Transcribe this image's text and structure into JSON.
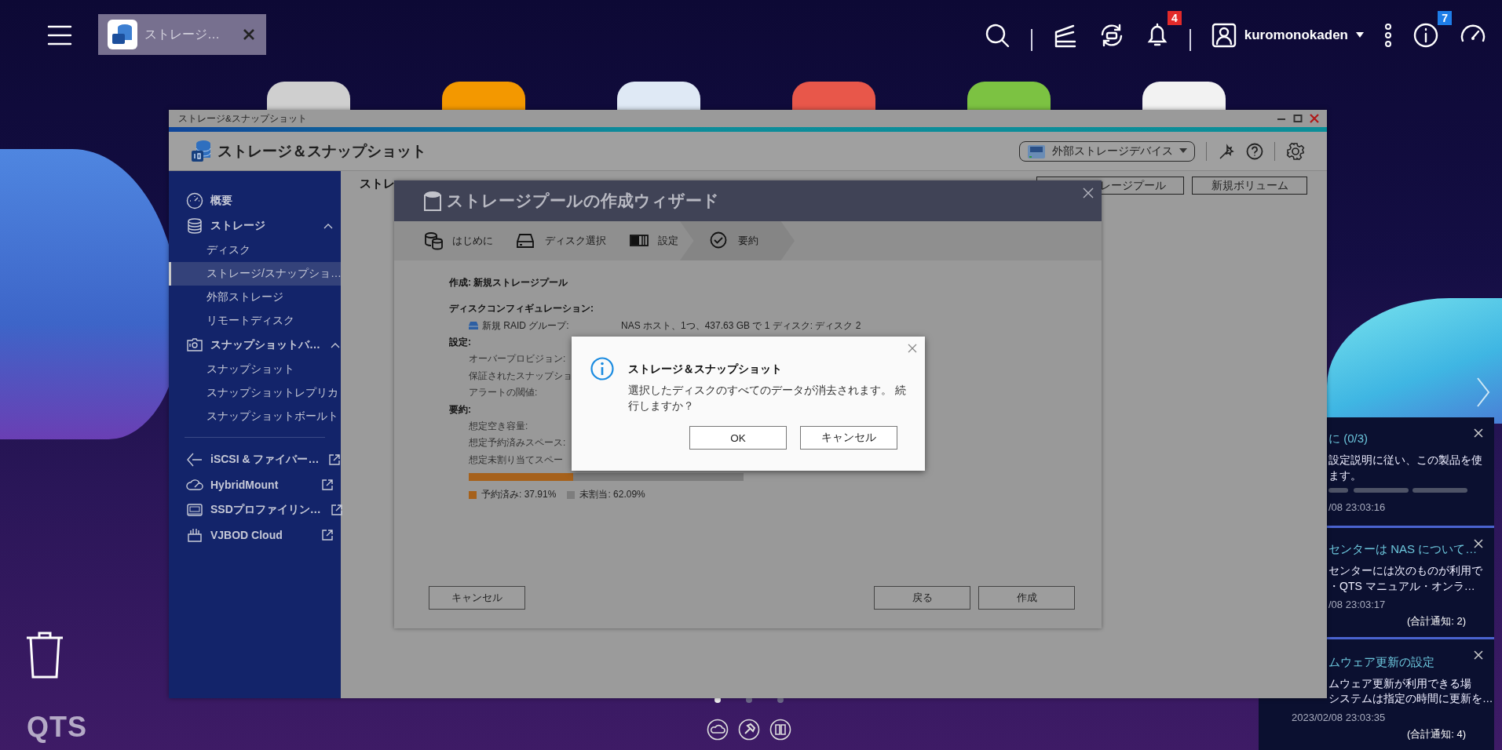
{
  "topbar": {
    "tab": {
      "label": "ストレージ…"
    },
    "notification_count": "4",
    "user": "kuromonokaden",
    "info_count": "7"
  },
  "main_window": {
    "title": "ストレージ&スナップショット",
    "app_title": "ストレージ＆スナップショット",
    "device_dropdown": "外部ストレージデバイス",
    "content_heading": "ストレ",
    "actions": [
      "レージプール",
      "新規ボリューム"
    ]
  },
  "sidebar": {
    "items": [
      {
        "kind": "item",
        "label": "概要",
        "selected": false
      },
      {
        "kind": "group",
        "label": "ストレージ",
        "selected": false,
        "expanded": true,
        "children": [
          {
            "label": "ディスク",
            "selected": false
          },
          {
            "label": "ストレージ/スナップショ…",
            "selected": true
          },
          {
            "label": "外部ストレージ",
            "selected": false
          },
          {
            "label": "リモートディスク",
            "selected": false
          }
        ]
      },
      {
        "kind": "group",
        "label": "スナップショットバ…",
        "selected": false,
        "expanded": true,
        "children": [
          {
            "label": "スナップショット",
            "selected": false
          },
          {
            "label": "スナップショットレプリカ",
            "selected": false
          },
          {
            "label": "スナップショットボールト",
            "selected": false
          }
        ]
      },
      {
        "kind": "link",
        "label": "iSCSI & ファイバー…",
        "selected": false
      },
      {
        "kind": "link",
        "label": "HybridMount",
        "selected": false
      },
      {
        "kind": "link",
        "label": "SSDプロファイリン…",
        "selected": false
      },
      {
        "kind": "link",
        "label": "VJBOD Cloud",
        "selected": false
      }
    ]
  },
  "wizard": {
    "title": "ストレージプールの作成ウィザード",
    "steps": [
      {
        "label": "はじめに",
        "selected": false
      },
      {
        "label": "ディスク選択",
        "selected": false
      },
      {
        "label": "設定",
        "selected": false
      },
      {
        "label": "要約",
        "selected": true
      }
    ],
    "rows": [
      {
        "kind": "heading",
        "text": "作成: 新規ストレージプール"
      },
      {
        "kind": "section",
        "text": "ディスクコンフィギュレーション:"
      },
      {
        "kind": "disk",
        "text": "新規 RAID グループ:",
        "value": "NAS ホスト、1つ、437.63 GB で 1 ディスク: ディスク 2"
      },
      {
        "kind": "section",
        "text": "設定:"
      },
      {
        "kind": "field",
        "text": "オーバープロビジョン:"
      },
      {
        "kind": "field",
        "text": "保証されたスナップショ"
      },
      {
        "kind": "field",
        "text": "アラートの閾値:"
      },
      {
        "kind": "section",
        "text": "要約:"
      },
      {
        "kind": "field",
        "text": "想定空き容量:"
      },
      {
        "kind": "field",
        "text": "想定予約済みスペース:"
      },
      {
        "kind": "field",
        "text": "想定未割り当てスペー"
      }
    ],
    "usage": {
      "level": 0.3791,
      "legend": [
        {
          "label": "予約済み: 37.91%",
          "color": "#a6611b"
        },
        {
          "label": "未割当: 62.09%",
          "color": "#7d7d7d"
        }
      ]
    },
    "buttons": {
      "cancel": "キャンセル",
      "back": "戻る",
      "create": "作成"
    }
  },
  "dialog": {
    "title": "ストレージ＆スナップショット",
    "message": [
      "選択したディスクのすべてのデータが消去されます。 続",
      "行しますか？"
    ],
    "buttons": [
      "OK",
      "キャンセル"
    ]
  },
  "notifications": [
    {
      "title": "に (0/3)",
      "body": [
        "設定説明に従い、この製品を使",
        "ます。"
      ],
      "time": "/08 23:03:16"
    },
    {
      "title": "センターは NAS について…",
      "body": [
        "センターには次のものが利用で",
        "・QTS マニュアル・オンラ…"
      ],
      "time": "/08 23:03:17",
      "count": "(合計通知: 2)"
    },
    {
      "title": "ムウェア更新の設定",
      "body": [
        "ムウェア更新が利用できる場",
        "システムは指定の時間に更新を…"
      ],
      "time": "2023/02/08 23:03:35",
      "count": "(合計通知: 4)"
    }
  ],
  "desktop": {
    "logo": "QTS",
    "pages": [
      {
        "selected": true
      },
      {
        "selected": false
      },
      {
        "selected": false
      }
    ]
  }
}
